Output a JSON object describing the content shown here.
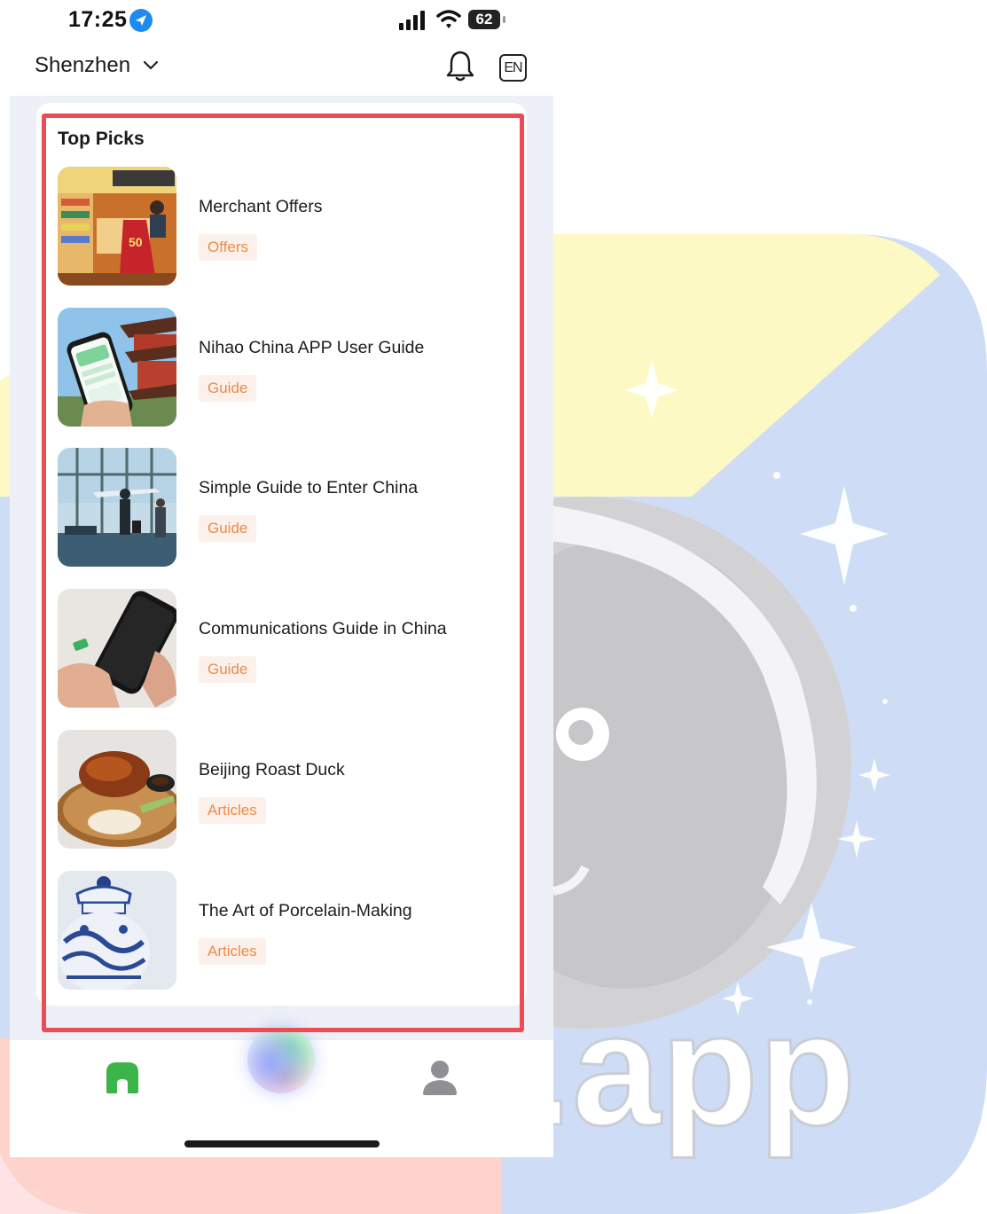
{
  "status_bar": {
    "time": "17:25",
    "battery": "62"
  },
  "header": {
    "city": "Shenzhen",
    "language": "EN"
  },
  "top_picks": {
    "title": "Top Picks",
    "items": [
      {
        "title": "Merchant Offers",
        "tag": "Offers",
        "image": "convenience-store-photo"
      },
      {
        "title": "Nihao China APP User Guide",
        "tag": "Guide",
        "image": "phone-app-pagoda-photo"
      },
      {
        "title": "Simple Guide to Enter China",
        "tag": "Guide",
        "image": "airport-travelers-photo"
      },
      {
        "title": "Communications Guide in China",
        "tag": "Guide",
        "image": "smartphone-sim-card-photo"
      },
      {
        "title": "Beijing Roast Duck",
        "tag": "Articles",
        "image": "roast-duck-photo"
      },
      {
        "title": "The Art of Porcelain-Making",
        "tag": "Articles",
        "image": "porcelain-jar-photo"
      }
    ]
  },
  "tabbar": {
    "items": [
      "home-icon",
      "ai-assistant-orb",
      "profile-icon"
    ]
  },
  "colors": {
    "accent_green": "#3bb54a",
    "tag_text": "#ec8a4a",
    "tag_bg": "#fbf1ea",
    "highlight": "#ee4b55",
    "page_bg": "#eef0f7"
  },
  "background": {
    "watermark_text": ".app"
  }
}
